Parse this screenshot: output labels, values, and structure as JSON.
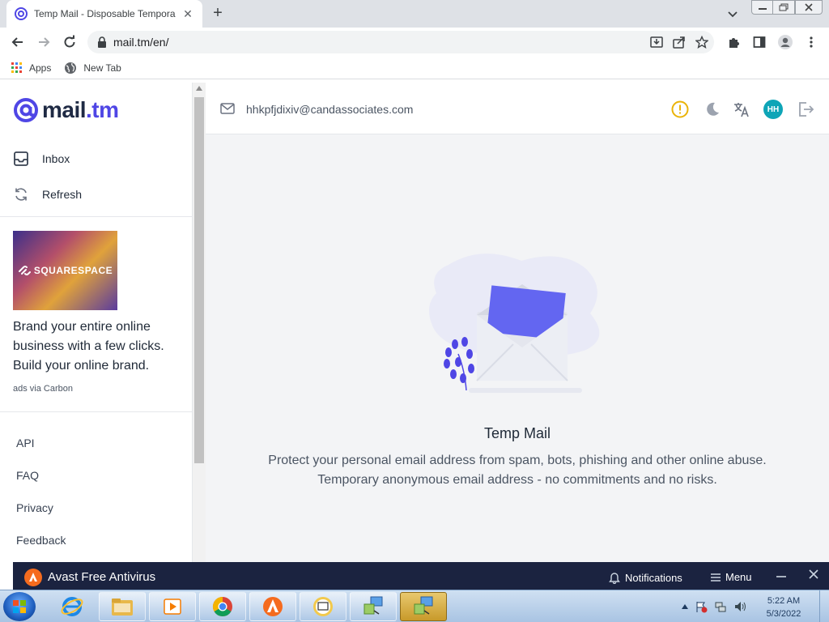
{
  "browser": {
    "tab_title": "Temp Mail - Disposable Tempora",
    "tab_close": "✕",
    "new_tab": "+",
    "url": "mail.tm/en/",
    "bookmarks": [
      {
        "label": "Apps",
        "icon": "apps-grid-icon"
      },
      {
        "label": "New Tab",
        "icon": "globe-icon"
      }
    ]
  },
  "sidebar": {
    "logo_at": "@",
    "logo_name": "mail",
    "logo_tld": ".tm",
    "nav": [
      {
        "label": "Inbox",
        "icon": "inbox-icon"
      },
      {
        "label": "Refresh",
        "icon": "refresh-icon"
      }
    ],
    "ad": {
      "brand": "SQUARESPACE",
      "text": "Brand your entire online business with a few clicks. Build your online brand.",
      "via": "ads via Carbon"
    },
    "footer_links": [
      "API",
      "FAQ",
      "Privacy",
      "Feedback"
    ]
  },
  "topbar": {
    "email": "hhkpfjdixiv@candassociates.com",
    "avatar_initials": "HH"
  },
  "empty_state": {
    "title": "Temp Mail",
    "line1": "Protect your personal email address from spam, bots, phishing and other online abuse.",
    "line2": "Temporary anonymous email address - no commitments and no risks."
  },
  "avast": {
    "title": "Avast Free Antivirus",
    "notifications": "Notifications",
    "menu": "Menu"
  },
  "taskbar": {
    "time": "5:22 AM",
    "date": "5/3/2022"
  },
  "colors": {
    "accent": "#4f46e5",
    "warning": "#eab308",
    "avatar": "#0ea5b7",
    "avast_bar": "#1b2340"
  }
}
